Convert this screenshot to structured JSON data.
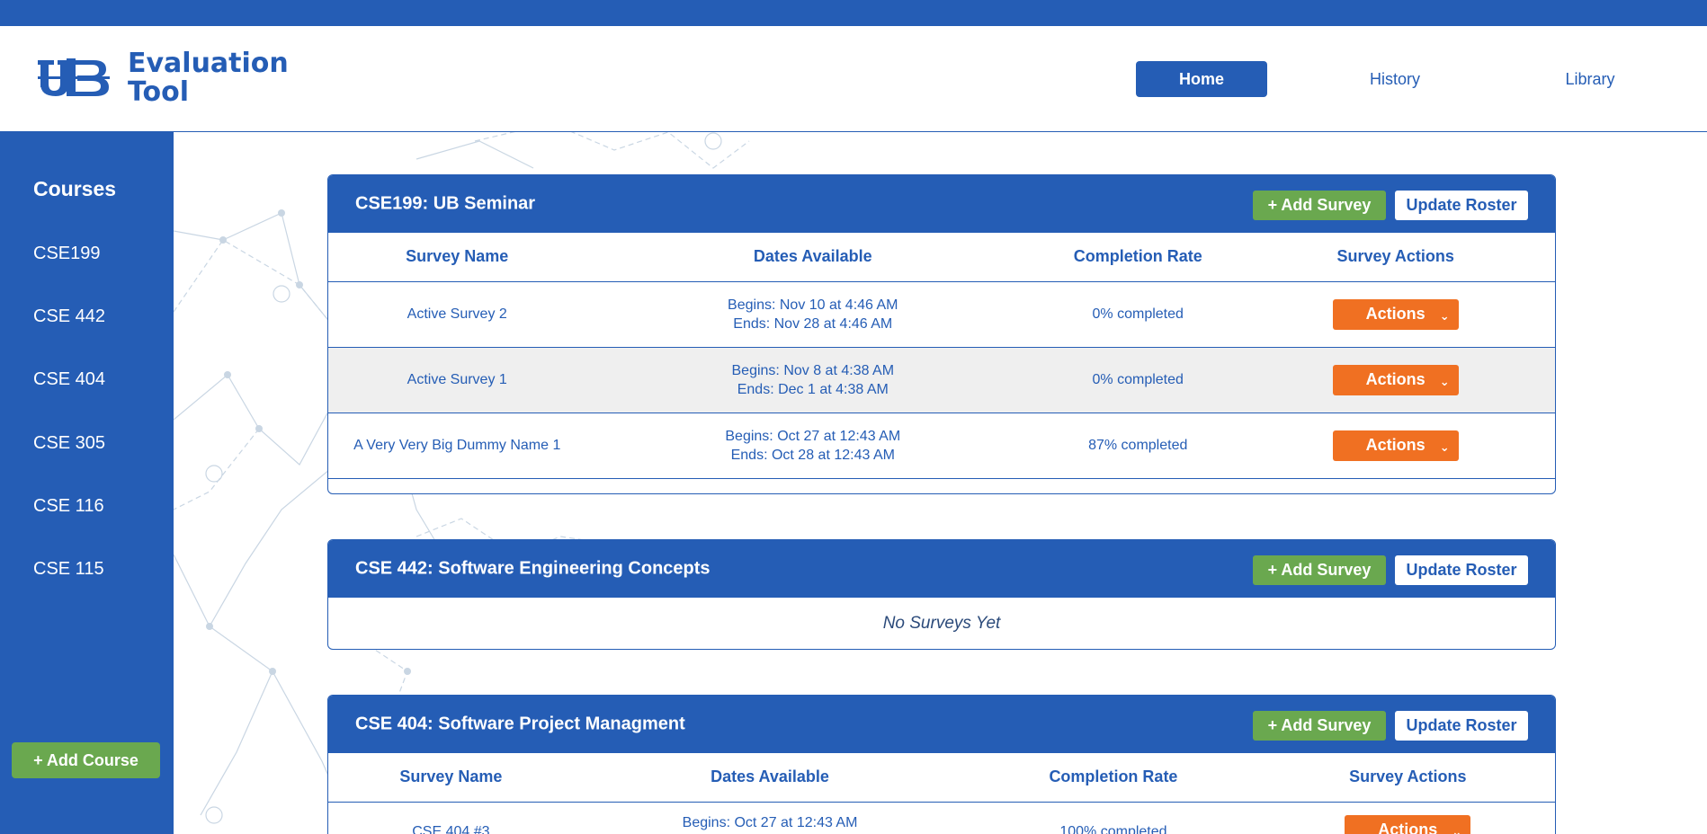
{
  "app": {
    "title_line1": "Evaluation",
    "title_line2": "Tool"
  },
  "nav": {
    "home": "Home",
    "history": "History",
    "library": "Library"
  },
  "sidebar": {
    "title": "Courses",
    "items": [
      "CSE199",
      "CSE 442",
      "CSE 404",
      "CSE 305",
      "CSE 116",
      "CSE 115"
    ],
    "add_course": "+ Add Course"
  },
  "labels": {
    "add_survey": "+ Add Survey",
    "update_roster": "Update Roster",
    "actions": "Actions",
    "no_surveys": "No Surveys Yet"
  },
  "table_headers": [
    "Survey Name",
    "Dates Available",
    "Completion Rate",
    "Survey Actions"
  ],
  "courses": [
    {
      "title": "CSE199: UB Seminar",
      "surveys": [
        {
          "name": "Active Survey 2",
          "begins": "Begins: Nov 10 at 4:46 AM",
          "ends": "Ends: Nov 28 at 4:46 AM",
          "completion": "0% completed"
        },
        {
          "name": "Active Survey 1",
          "begins": "Begins: Nov 8 at 4:38 AM",
          "ends": "Ends: Dec 1 at 4:38 AM",
          "completion": "0% completed"
        },
        {
          "name": "A Very Very Big Dummy Name 1",
          "begins": "Begins: Oct 27 at 12:43 AM",
          "ends": "Ends: Oct 28 at 12:43 AM",
          "completion": "87% completed"
        }
      ]
    },
    {
      "title": "CSE 442: Software Engineering Concepts",
      "surveys": []
    },
    {
      "title": "CSE 404: Software Project Managment",
      "surveys": [
        {
          "name": "CSE 404 #3",
          "begins": "Begins: Oct 27 at 12:43 AM",
          "ends": "",
          "completion": "100% completed"
        }
      ]
    }
  ],
  "colors": {
    "primary": "#255db5",
    "green": "#6aa84f",
    "orange": "#f07022",
    "row_shade": "#efefef"
  }
}
